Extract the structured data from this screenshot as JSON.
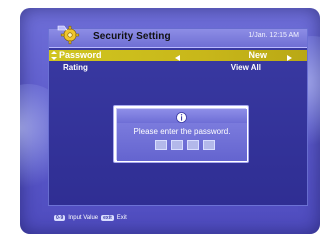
{
  "window": {
    "title": "Security Setting",
    "datetime": "1/Jan. 12:15 AM"
  },
  "settings": [
    {
      "label": "Password",
      "value": "New",
      "selected": true
    },
    {
      "label": "Rating",
      "value": "View All",
      "selected": false
    }
  ],
  "dialog": {
    "message": "Please enter the password.",
    "password_digits": [
      "",
      "",
      "",
      ""
    ]
  },
  "footer": {
    "hints": [
      {
        "key": "0-9",
        "label": "Input Value"
      },
      {
        "key": "exit",
        "label": "Exit"
      }
    ]
  },
  "icons": {
    "header": "gear-icon",
    "row_indicator": "updown-arrow-icon",
    "value_left": "arrow-left-icon",
    "value_right": "arrow-right-icon",
    "dialog": "info-icon"
  },
  "colors": {
    "screen_bg": "#5a58c8",
    "panel_bg": "#2f2e93",
    "header_bg": "#8d8de6",
    "selected_row_bg": "#c8b71a",
    "text": "#ffffff"
  }
}
